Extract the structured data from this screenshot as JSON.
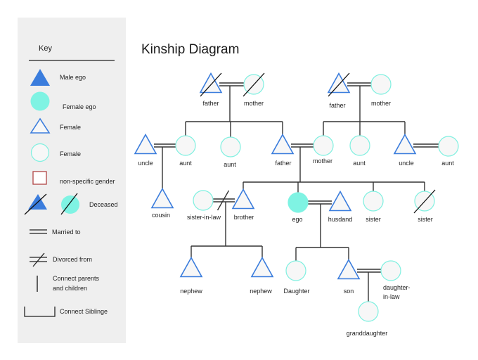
{
  "title": "Kinship Diagram",
  "colors": {
    "male_stroke": "#3b7ddd",
    "male_fill_ego": "#3b7ddd",
    "female_stroke": "#7ff0e0",
    "female_fill_ego": "#7ff3e3",
    "node_fill": "#f7f7f7",
    "nonspecific_stroke": "#b04444",
    "line": "#333333",
    "legend_bg": "#efefef"
  },
  "legend": {
    "heading": "Key",
    "items": [
      {
        "symbol": "male-ego",
        "label": "Male ego"
      },
      {
        "symbol": "female-ego",
        "label": "Female ego"
      },
      {
        "symbol": "male",
        "label": "Female"
      },
      {
        "symbol": "female",
        "label": "Female"
      },
      {
        "symbol": "nonspecific",
        "label": "non-specific gender"
      },
      {
        "symbol": "deceased",
        "label": "Deceased"
      },
      {
        "symbol": "married",
        "label": "Married to"
      },
      {
        "symbol": "divorced",
        "label": "Divorced from"
      },
      {
        "symbol": "parent-child",
        "label": "Connect parents and children",
        "lines": [
          "Connect parents",
          "and children"
        ]
      },
      {
        "symbol": "siblings",
        "label": "Connect Siblinge"
      }
    ]
  },
  "people": [
    {
      "id": "pgf",
      "label": "father",
      "sex": "male",
      "deceased": true
    },
    {
      "id": "pgm",
      "label": "mother",
      "sex": "female",
      "deceased": true
    },
    {
      "id": "mgf",
      "label": "father",
      "sex": "male",
      "deceased": true
    },
    {
      "id": "mgm",
      "label": "mother",
      "sex": "female",
      "deceased": false
    },
    {
      "id": "uncle1",
      "label": "uncle",
      "sex": "male",
      "deceased": false
    },
    {
      "id": "aunt1",
      "label": "aunt",
      "sex": "female",
      "deceased": false
    },
    {
      "id": "aunt2",
      "label": "aunt",
      "sex": "female",
      "deceased": false
    },
    {
      "id": "father",
      "label": "father",
      "sex": "male",
      "deceased": false
    },
    {
      "id": "mother",
      "label": "mother",
      "sex": "female",
      "deceased": false
    },
    {
      "id": "aunt3",
      "label": "aunt",
      "sex": "female",
      "deceased": false
    },
    {
      "id": "uncle2",
      "label": "uncle",
      "sex": "male",
      "deceased": false
    },
    {
      "id": "aunt4",
      "label": "aunt",
      "sex": "female",
      "deceased": false
    },
    {
      "id": "cousin",
      "label": "cousin",
      "sex": "male",
      "deceased": false
    },
    {
      "id": "sil",
      "label": "sister-in-law",
      "sex": "female",
      "deceased": false
    },
    {
      "id": "brother",
      "label": "brother",
      "sex": "male",
      "deceased": false
    },
    {
      "id": "ego",
      "label": "ego",
      "sex": "female",
      "ego": true,
      "deceased": false
    },
    {
      "id": "husband",
      "label": "husdand",
      "sex": "male",
      "deceased": false
    },
    {
      "id": "sister1",
      "label": "sister",
      "sex": "female",
      "deceased": false
    },
    {
      "id": "sister2",
      "label": "sister",
      "sex": "female",
      "deceased": true
    },
    {
      "id": "nephew1",
      "label": "nephew",
      "sex": "male",
      "deceased": false
    },
    {
      "id": "nephew2",
      "label": "nephew",
      "sex": "male",
      "deceased": false
    },
    {
      "id": "daughter",
      "label": "Daughter",
      "sex": "female",
      "deceased": false
    },
    {
      "id": "son",
      "label": "son",
      "sex": "male",
      "deceased": false
    },
    {
      "id": "dil",
      "label": "daughter-in-law",
      "sex": "female",
      "deceased": false,
      "lines": [
        "daughter-",
        "in-law"
      ]
    },
    {
      "id": "granddaughter",
      "label": "granddaughter",
      "sex": "female",
      "deceased": false
    }
  ],
  "unions": [
    {
      "a": "pgf",
      "b": "pgm",
      "type": "married",
      "children": [
        "aunt1",
        "aunt2",
        "father"
      ]
    },
    {
      "a": "mgf",
      "b": "mgm",
      "type": "married",
      "children": [
        "mother",
        "aunt3",
        "uncle2"
      ]
    },
    {
      "a": "uncle1",
      "b": "aunt1",
      "type": "married",
      "children": [
        "cousin"
      ]
    },
    {
      "a": "father",
      "b": "mother",
      "type": "married",
      "children": [
        "brother",
        "ego",
        "sister1",
        "sister2"
      ]
    },
    {
      "a": "uncle2",
      "b": "aunt4",
      "type": "married",
      "children": []
    },
    {
      "a": "sil",
      "b": "brother",
      "type": "divorced",
      "children": [
        "nephew1",
        "nephew2"
      ]
    },
    {
      "a": "ego",
      "b": "husband",
      "type": "married",
      "children": [
        "daughter",
        "son"
      ]
    },
    {
      "a": "son",
      "b": "dil",
      "type": "married",
      "children": [
        "granddaughter"
      ]
    }
  ]
}
